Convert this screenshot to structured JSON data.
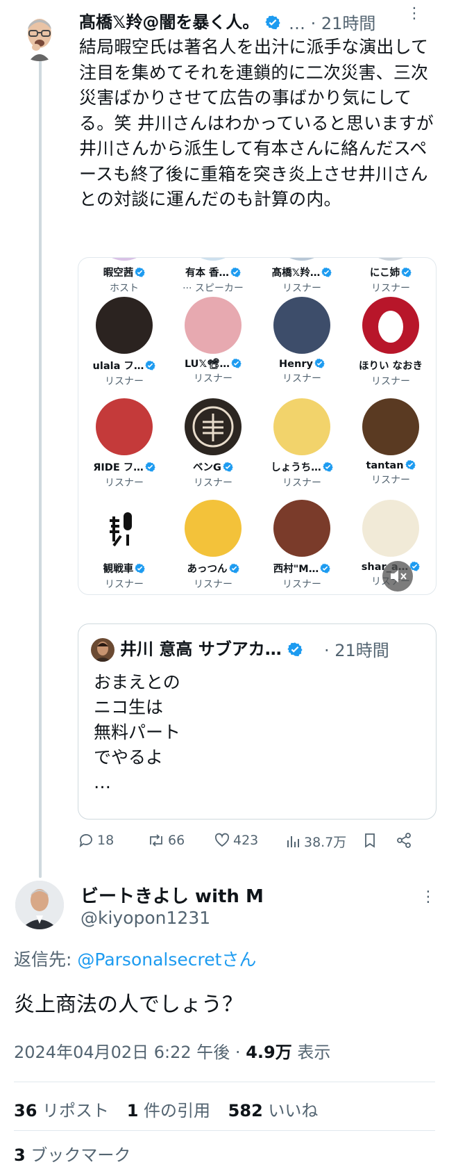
{
  "tweet1": {
    "name": "髙橋𝕏羚@闇を暴く人。",
    "meta": "… · 21時間",
    "body": "結局暇空氏は著名人を出汁に派手な演出して注目を集めてそれを連鎖的に二次災害、三次災害ばかりさせて広告の事ばかり気にしてる。笑 井川さんはわかっていると思いますが井川さんから派生して有本さんに絡んだスペースも終了後に重箱を突き炎上させ井川さんとの対談に運んだのも計算の内。",
    "space_grid": [
      {
        "name": "暇空茜",
        "role": "ホスト"
      },
      {
        "name": "有本 香…",
        "role": "··· スピーカー"
      },
      {
        "name": "髙橋𝕏羚…",
        "role": "リスナー"
      },
      {
        "name": "にこ姉",
        "role": "リスナー"
      },
      {
        "name": "ulala フ…",
        "role": "リスナー"
      },
      {
        "name": "LU𝕏📽…",
        "role": "リスナー"
      },
      {
        "name": "Henry",
        "role": "リスナー"
      },
      {
        "name": "ほりい なおき",
        "role": "リスナー"
      },
      {
        "name": "ЯIDE フ…",
        "role": "リスナー"
      },
      {
        "name": "ベンG",
        "role": "リスナー"
      },
      {
        "name": "しょうち…",
        "role": "リスナー"
      },
      {
        "name": "tantan",
        "role": "リスナー"
      },
      {
        "name": "観戦車",
        "role": "リスナー"
      },
      {
        "name": "あっつん",
        "role": "リスナー"
      },
      {
        "name": "西村\"M…",
        "role": "リスナー"
      },
      {
        "name": "shar_a…",
        "role": "リスナー"
      }
    ],
    "quote": {
      "name": "井川 意高 サブアカ…",
      "meta": "· 21時間",
      "lines": [
        "おまえとの",
        "ニコ生は",
        "無料パート",
        "でやるよ",
        "…"
      ]
    },
    "actions": {
      "replies": "18",
      "reposts": "66",
      "likes": "423",
      "views": "38.7万"
    }
  },
  "tweet2": {
    "name": "ビートきよし with M",
    "handle": "@kiyopon1231",
    "reply_prefix": "返信先: ",
    "reply_to": "@Parsonalsecretさん",
    "body": "炎上商法の人でしょう？",
    "timestamp": "2024年04月02日 6:22 午後 · ",
    "views_count": "4.9万",
    "views_label": " 表示",
    "reposts_count": "36",
    "reposts_label": " リポスト",
    "quotes_count": "1",
    "quotes_label": " 件の引用",
    "likes_count": "582",
    "likes_label": " いいね",
    "bookmarks_count": "3",
    "bookmarks_label": " ブックマーク"
  },
  "colors": {
    "accent": "#1d9bf0",
    "text": "#0f1419",
    "muted": "#536471",
    "border": "#e1e8ed"
  }
}
